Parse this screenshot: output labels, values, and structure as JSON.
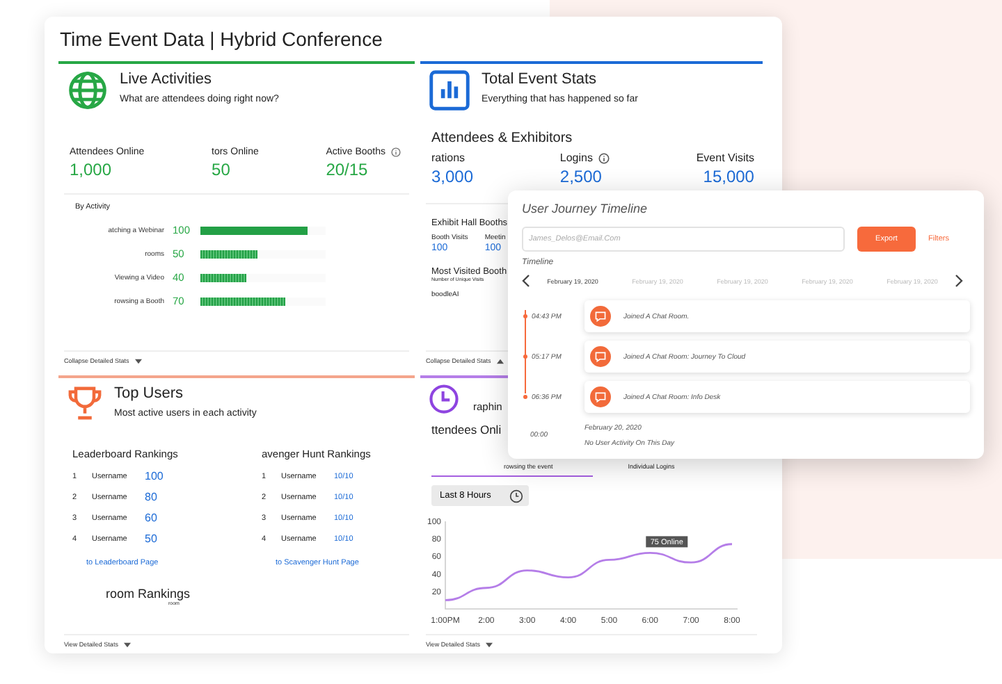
{
  "window": {
    "title": "Time Event Data | Hybrid Conference"
  },
  "live_activities": {
    "title": "Live Activities",
    "subtitle": "What are attendees doing right now?",
    "stats": [
      {
        "label": "Attendees Online",
        "value": "1,000",
        "info": false
      },
      {
        "label": "tors Online",
        "value": "50",
        "info": false
      },
      {
        "label": "Active Booths",
        "value": "20/15",
        "info": true
      }
    ],
    "by_activity_label": "By Activity",
    "activities": [
      {
        "name": "atching a Webinar",
        "value": "100",
        "level": 0.85,
        "pattern": false
      },
      {
        "name": "rooms",
        "value": "50",
        "level": 0.45,
        "pattern": true
      },
      {
        "name": "Viewing a Video",
        "value": "40",
        "level": 0.37,
        "pattern": true
      },
      {
        "name": "rowsing a Booth",
        "value": "70",
        "level": 0.68,
        "pattern": true
      }
    ],
    "footer": "Collapse Detailed Stats"
  },
  "total_event_stats": {
    "title": "Total Event Stats",
    "subtitle": "Everything that has happened so far",
    "section": "Attendees & Exhibitors",
    "stats": [
      {
        "label": "rations",
        "value": "3,000",
        "info": false
      },
      {
        "label": "Logins",
        "value": "2,500",
        "info": true
      },
      {
        "label": "Event Visits",
        "value": "15,000",
        "info": false
      }
    ],
    "booths_title": "Exhibit Hall Booths",
    "booth_stats": [
      {
        "label": "Booth Visits",
        "value": "100"
      },
      {
        "label": "Meetin",
        "value": "100"
      }
    ],
    "most_visited_title": "Most Visited Booth",
    "most_visited_caption": "Number of Unique Visits",
    "most_visited_name": "boodleAI",
    "footer": "Collapse Detailed Stats"
  },
  "top_users": {
    "title": "Top Users",
    "subtitle": "Most active users in each activity",
    "lists": [
      {
        "title": "Leaderboard Rankings",
        "rows": [
          {
            "rank": "1",
            "name": "Username",
            "score": "100"
          },
          {
            "rank": "2",
            "name": "Username",
            "score": "80"
          },
          {
            "rank": "3",
            "name": "Username",
            "score": "60"
          },
          {
            "rank": "4",
            "name": "Username",
            "score": "50"
          }
        ],
        "link": "to Leaderboard Page",
        "large": true
      },
      {
        "title": "avenger Hunt Rankings",
        "rows": [
          {
            "rank": "1",
            "name": "Username",
            "score": "10/10"
          },
          {
            "rank": "2",
            "name": "Username",
            "score": "10/10"
          },
          {
            "rank": "3",
            "name": "Username",
            "score": "10/10"
          },
          {
            "rank": "4",
            "name": "Username",
            "score": "10/10"
          }
        ],
        "link": "to Scavenger Hunt Page",
        "large": false
      }
    ],
    "room_title": "room Rankings",
    "room_caption": "room",
    "footer": "View Detailed Stats"
  },
  "graphs": {
    "title": "raphin",
    "tab_label": "ttendees Onli",
    "captions": [
      "rowsing the event",
      "Individual Logins"
    ],
    "range_button": "Last 8 Hours",
    "tooltip": "75 Online",
    "chart_data": {
      "type": "line",
      "x": [
        "1:00PM",
        "2:00",
        "3:00",
        "4:00",
        "5:00",
        "6:00",
        "7:00",
        "8:00"
      ],
      "ylim": [
        0,
        100
      ],
      "yticks": [
        20,
        40,
        60,
        80,
        100
      ],
      "series": [
        {
          "color": "#b57ee8",
          "values": [
            10,
            24,
            44,
            36,
            56,
            64,
            53,
            74
          ]
        }
      ]
    },
    "footer": "View Detailed Stats"
  },
  "journey": {
    "title": "User Journey Timeline",
    "placeholder": "James_Delos@Email.Com",
    "export": "Export",
    "filters": "Filters",
    "timeline_label": "Timeline",
    "dates": [
      {
        "label": "February 19, 2020",
        "selected": true
      },
      {
        "label": "February 19, 2020",
        "selected": false
      },
      {
        "label": "February 19, 2020",
        "selected": false
      },
      {
        "label": "February 19, 2020",
        "selected": false
      },
      {
        "label": "February 19, 2020",
        "selected": false
      }
    ],
    "events": [
      {
        "time": "04:43 PM",
        "text": "Joined A Chat Room."
      },
      {
        "time": "05:17 PM",
        "text": "Joined A Chat Room: Journey To Cloud"
      },
      {
        "time": "06:36 PM",
        "text": "Joined A Chat Room: Info Desk"
      }
    ],
    "empty": {
      "time": "00:00",
      "date": "February 20, 2020",
      "text": "No User Activity On This Day"
    }
  }
}
